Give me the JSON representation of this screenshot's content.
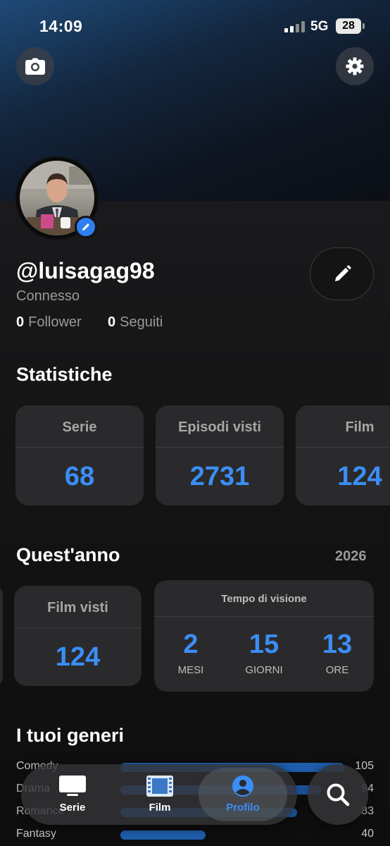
{
  "status_bar": {
    "time": "14:09",
    "network": "5G",
    "battery": "28"
  },
  "header": {
    "camera_icon": "camera-icon",
    "settings_icon": "gear-icon"
  },
  "profile": {
    "username": "@luisagag98",
    "status": "Connesso",
    "followers_count": "0",
    "followers_label": "Follower",
    "following_count": "0",
    "following_label": "Seguiti"
  },
  "stats": {
    "title": "Statistiche",
    "cards": [
      {
        "label": "Serie",
        "value": "68"
      },
      {
        "label": "Episodi visti",
        "value": "2731"
      },
      {
        "label": "Film",
        "value": "124"
      }
    ]
  },
  "this_year": {
    "title": "Quest'anno",
    "year": "2026",
    "movies_card": {
      "label": "Film visti",
      "value": "124"
    },
    "watch_time": {
      "label": "Tempo di visione",
      "items": [
        {
          "value": "2",
          "unit": "MESI"
        },
        {
          "value": "15",
          "unit": "GIORNI"
        },
        {
          "value": "13",
          "unit": "ORE"
        }
      ]
    }
  },
  "genres": {
    "title": "I tuoi generi",
    "items": [
      {
        "name": "Comedy",
        "count": "105",
        "fraction": 1.0
      },
      {
        "name": "Drama",
        "count": "94",
        "fraction": 0.9
      },
      {
        "name": "Romance",
        "count": "83",
        "fraction": 0.79
      },
      {
        "name": "Fantasy",
        "count": "40",
        "fraction": 0.38
      }
    ]
  },
  "tabbar": {
    "tabs": [
      {
        "label": "Serie",
        "icon": "tv-icon",
        "active": false
      },
      {
        "label": "Film",
        "icon": "film-icon",
        "active": false
      },
      {
        "label": "Profilo",
        "icon": "profile-icon",
        "active": true
      }
    ],
    "search_icon": "search-icon"
  },
  "colors": {
    "accent": "#3b8ef5",
    "card": "#2a2a2c",
    "background": "#111111"
  }
}
